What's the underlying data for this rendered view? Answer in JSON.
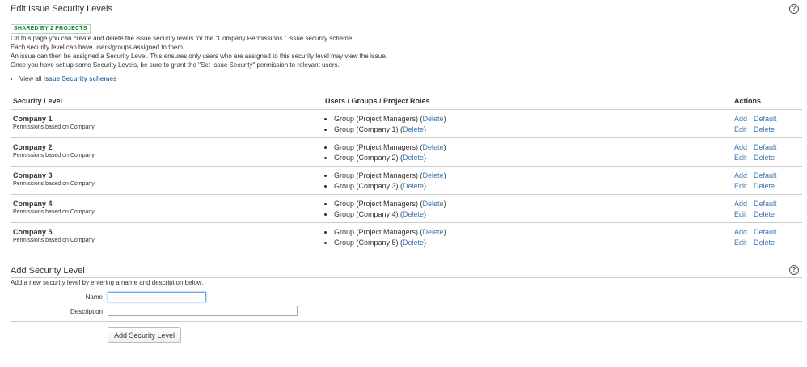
{
  "header": {
    "title": "Edit Issue Security Levels",
    "badge": "SHARED BY 2 PROJECTS",
    "help_icon": "question-circle-icon"
  },
  "intro": {
    "line1": "On this page you can create and delete the issue security levels for the \"Company Permissions \" issue security scheme.",
    "line2": "Each security level can have users/groups assigned to them.",
    "line3": "An issue can then be assigned a Security Level. This ensures only users who are assigned to this security level may view the issue.",
    "line4": "Once you have set up some Security Levels, be sure to grant the \"Set Issue Security\" permission to relevant users.",
    "view_all_prefix": "View all",
    "view_all_link": "Issue Security schemes"
  },
  "table": {
    "headers": [
      "Security Level",
      "Users / Groups / Project Roles",
      "Actions"
    ],
    "rows": [
      {
        "name": "Company 1",
        "desc": "Permissions based on Company",
        "perms": [
          {
            "text": "Group (Project Managers) (",
            "link": "Delete",
            "close": ")"
          },
          {
            "text": "Group (Company 1) (",
            "link": "Delete",
            "close": ")"
          }
        ],
        "actions": [
          "Add",
          "Default",
          "Edit",
          "Delete"
        ]
      },
      {
        "name": "Company 2",
        "desc": "Permissions based on Company",
        "perms": [
          {
            "text": "Group (Project Managers) (",
            "link": "Delete",
            "close": ")"
          },
          {
            "text": "Group (Company 2) (",
            "link": "Delete",
            "close": ")"
          }
        ],
        "actions": [
          "Add",
          "Default",
          "Edit",
          "Delete"
        ]
      },
      {
        "name": "Company 3",
        "desc": "Permissions based on Company",
        "perms": [
          {
            "text": "Group (Project Managers) (",
            "link": "Delete",
            "close": ")"
          },
          {
            "text": "Group (Company 3) (",
            "link": "Delete",
            "close": ")"
          }
        ],
        "actions": [
          "Add",
          "Default",
          "Edit",
          "Delete"
        ]
      },
      {
        "name": "Company 4",
        "desc": "Permissions based on Company",
        "perms": [
          {
            "text": "Group (Project Managers) (",
            "link": "Delete",
            "close": ")"
          },
          {
            "text": "Group (Company 4) (",
            "link": "Delete",
            "close": ")"
          }
        ],
        "actions": [
          "Add",
          "Default",
          "Edit",
          "Delete"
        ]
      },
      {
        "name": "Company 5",
        "desc": "Permissions based on Company",
        "perms": [
          {
            "text": "Group (Project Managers) (",
            "link": "Delete",
            "close": ")"
          },
          {
            "text": "Group (Company 5) (",
            "link": "Delete",
            "close": ")"
          }
        ],
        "actions": [
          "Add",
          "Default",
          "Edit",
          "Delete"
        ]
      }
    ]
  },
  "add_form": {
    "title": "Add Security Level",
    "help_icon": "question-circle-icon",
    "description": "Add a new security level by entering a name and description below.",
    "name_label": "Name",
    "name_value": "",
    "description_label": "Description",
    "description_value": "",
    "submit_label": "Add Security Level"
  },
  "colors": {
    "link": "#3b73af",
    "badge_text": "#14892c",
    "divider": "#cccccc",
    "text": "#333333"
  }
}
